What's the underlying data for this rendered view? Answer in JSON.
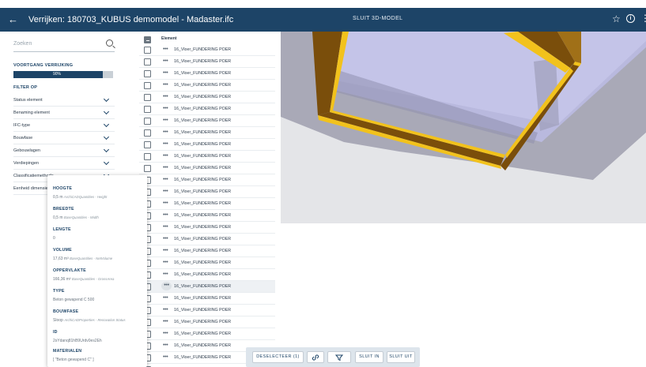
{
  "header": {
    "back_icon": "arrow-left-icon",
    "title": "Verrijken: 180703_KUBUS demomodel - Madaster.ifc",
    "center_action": "SLUIT 3D-MODEL",
    "star_icon": "star-icon",
    "info_icon": "info-icon",
    "more_icon": "more-icon"
  },
  "filter": {
    "search_placeholder": "Zoeken",
    "search_icon": "search-icon",
    "progress_label": "VOORTGANG VERRIJKING",
    "progress_text": "90%",
    "progress_value": 0.9,
    "filter_heading": "FILTER OP",
    "items": [
      {
        "label": "Status element"
      },
      {
        "label": "Benaming element"
      },
      {
        "label": "IFC-type"
      },
      {
        "label": "Bouwfase"
      },
      {
        "label": "Gebouwlagen"
      },
      {
        "label": "Verdiepingen"
      },
      {
        "label": "Classificatiemethode"
      },
      {
        "label": "Eenheid dimensie"
      }
    ]
  },
  "list": {
    "column_header": "Element",
    "more_glyph": "•••",
    "rows": [
      "16_Vloer_FUNDERING POER",
      "16_Vloer_FUNDERING POER",
      "16_Vloer_FUNDERING POER",
      "16_Vloer_FUNDERING POER",
      "16_Vloer_FUNDERING POER",
      "16_Vloer_FUNDERING POER",
      "16_Vloer_FUNDERING POER",
      "16_Vloer_FUNDERING POER",
      "16_Vloer_FUNDERING POER",
      "16_Vloer_FUNDERING POER",
      "16_Vloer_FUNDERING POER",
      "16_Vloer_FUNDERING POER",
      "16_Vloer_FUNDERING POER",
      "16_Vloer_FUNDERING POER",
      "16_Vloer_FUNDERING POER",
      "16_Vloer_FUNDERING POER",
      "16_Vloer_FUNDERING POER",
      "16_Vloer_FUNDERING POER",
      "16_Vloer_FUNDERING POER",
      "16_Vloer_FUNDERING POER",
      "16_Vloer_FUNDERING POER",
      "16_Vloer_FUNDERING POER",
      "16_Vloer_FUNDERING POER",
      "16_Vloer_FUNDERING POER",
      "16_Vloer_FUNDERING POER",
      "16_Vloer_FUNDERING POER",
      "16_Vloer_FUNDERING POER",
      "16_Vloer_FUNDERING POER"
    ],
    "active_row": 20
  },
  "popup": {
    "props": [
      {
        "key": "HOOGTE",
        "value": "0,5",
        "unit": "m",
        "source": "ArchiCADQuantities - Height"
      },
      {
        "key": "BREEDTE",
        "value": "0,5",
        "unit": "m",
        "source": "BaseQuantities - Width"
      },
      {
        "key": "LENGTE",
        "value": "0",
        "unit": "",
        "source": ""
      },
      {
        "key": "VOLUME",
        "value": "17,63",
        "unit": "m³",
        "source": "BaseQuantities - NetVolume"
      },
      {
        "key": "OPPERVLAKTE",
        "value": "166,36",
        "unit": "m²",
        "source": "BaseQuantities - GrossArea"
      },
      {
        "key": "TYPE",
        "value": "Beton gewapend C 500",
        "unit": "",
        "source": ""
      },
      {
        "key": "BOUWFASE",
        "value": "Sloop",
        "unit": "",
        "source": "ArchiCADProperties - Renovation Status"
      },
      {
        "key": "ID",
        "value": "2sYdanq81hB9Urdv0es2Eh",
        "unit": "",
        "source": ""
      },
      {
        "key": "MATERIALEN",
        "value": "[ \"Beton gewapend C\" ]",
        "unit": "",
        "source": ""
      }
    ]
  },
  "actions": {
    "deselect_label": "DESELECTEER (1)",
    "link_icon": "link-icon",
    "filter_icon": "filter-icon",
    "collapse_label": "SLUIT IN",
    "close_label": "SLUIT UIT"
  },
  "colors": {
    "brand": "#1d4467",
    "beam_yellow": "#f2c21c",
    "beam_brown": "#7a4e0b",
    "panel_lavender": "#b8b8dc"
  }
}
